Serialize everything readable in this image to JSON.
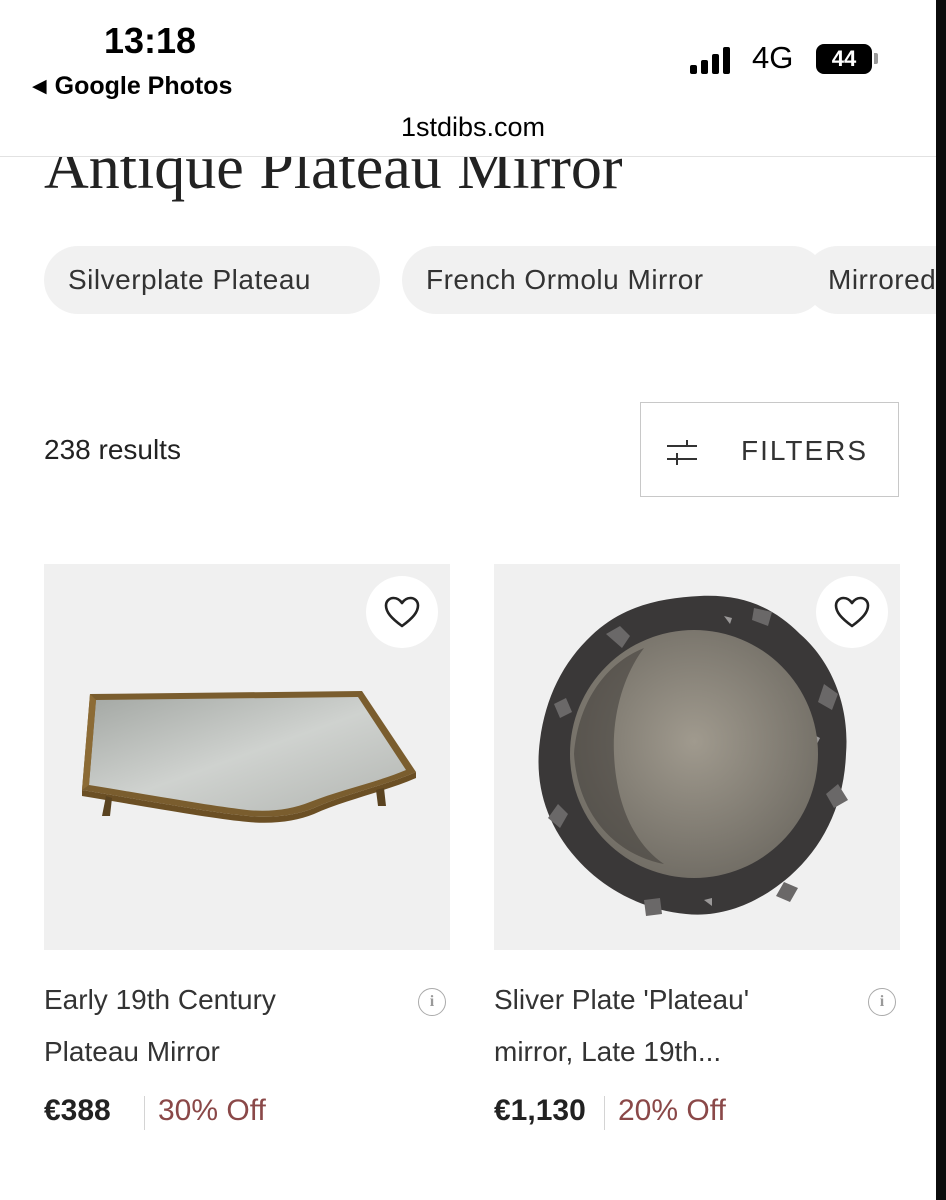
{
  "status_bar": {
    "time": "13:18",
    "back_app": "Google Photos",
    "network": "4G",
    "battery": "44"
  },
  "browser": {
    "url": "1stdibs.com"
  },
  "page": {
    "title": "Antique Plateau Mirror",
    "chips": [
      "Silverplate Plateau",
      "French Ormolu Mirror",
      "Mirrored"
    ],
    "results_count": "238 results",
    "filters_label": "FILTERS"
  },
  "products": [
    {
      "title": "Early 19th Century Plateau Mirror",
      "price": "€388",
      "discount": "30% Off",
      "image": "gilt-plateau-mirror-tray"
    },
    {
      "title": "Sliver Plate 'Plateau' mirror, Late 19th...",
      "price": "€1,130",
      "discount": "20% Off",
      "image": "round-silver-rock-frame-mirror"
    }
  ],
  "icons": {
    "back": "back-triangle-icon",
    "signal": "cellular-signal-icon",
    "filter": "filter-sliders-icon",
    "favorite": "heart-outline-icon",
    "info": "info-circle-icon"
  },
  "colors": {
    "chip_bg": "#f1f1f1",
    "discount": "#8a4848",
    "image_bg": "#f0f0f0"
  }
}
